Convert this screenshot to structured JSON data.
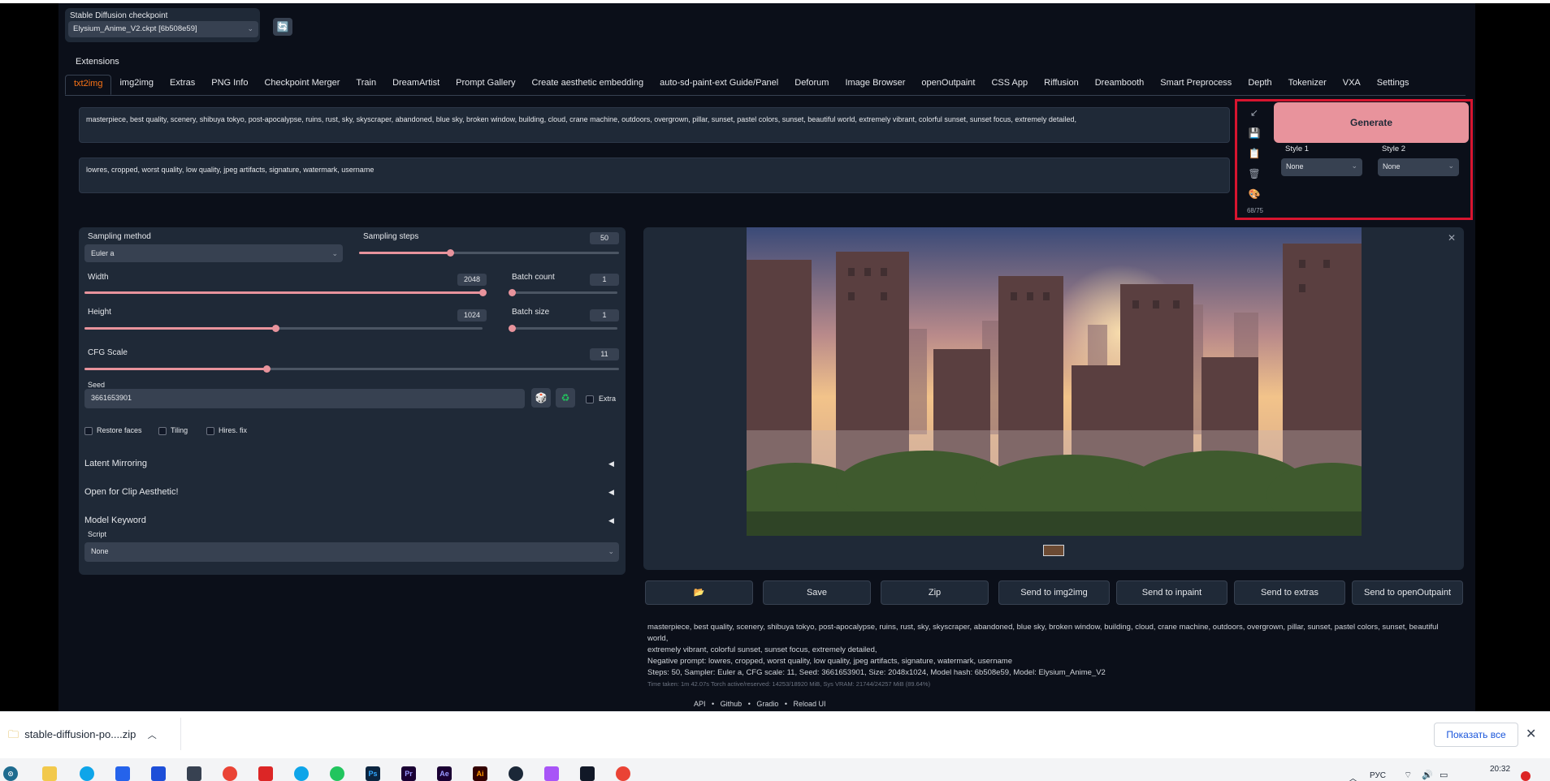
{
  "checkpoint": {
    "label": "Stable Diffusion checkpoint",
    "value": "Elysium_Anime_V2.ckpt [6b508e59]"
  },
  "extensions_label": "Extensions",
  "tabs": [
    "txt2img",
    "img2img",
    "Extras",
    "PNG Info",
    "Checkpoint Merger",
    "Train",
    "DreamArtist",
    "Prompt Gallery",
    "Create aesthetic embedding",
    "auto-sd-paint-ext Guide/Panel",
    "Deforum",
    "Image Browser",
    "openOutpaint",
    "CSS App",
    "Riffusion",
    "Dreambooth",
    "Smart Preprocess",
    "Depth",
    "Tokenizer",
    "VXA",
    "Settings"
  ],
  "prompt": "masterpiece, best quality, scenery, shibuya tokyo, post-apocalypse, ruins, rust, sky, skyscraper, abandoned, blue sky, broken window, building, cloud, crane machine, outdoors, overgrown, pillar, sunset, pastel colors, sunset, beautiful world, extremely vibrant, colorful sunset, sunset focus, extremely detailed,",
  "negative_prompt": "lowres, cropped, worst quality, low quality, jpeg artifacts, signature, watermark, username",
  "token_count": "68/75",
  "generate_label": "Generate",
  "style1": {
    "label": "Style 1",
    "value": "None"
  },
  "style2": {
    "label": "Style 2",
    "value": "None"
  },
  "sampling_method": {
    "label": "Sampling method",
    "value": "Euler a"
  },
  "sampling_steps": {
    "label": "Sampling steps",
    "value": "50",
    "fraction": 0.35
  },
  "width": {
    "label": "Width",
    "value": "2048",
    "fraction": 1.0
  },
  "height": {
    "label": "Height",
    "value": "1024",
    "fraction": 0.48
  },
  "batch_count": {
    "label": "Batch count",
    "value": "1",
    "fraction": 0.0
  },
  "batch_size": {
    "label": "Batch size",
    "value": "1",
    "fraction": 0.0
  },
  "cfg_scale": {
    "label": "CFG Scale",
    "value": "11",
    "fraction": 0.34
  },
  "seed": {
    "label": "Seed",
    "value": "3661653901",
    "extra_label": "Extra"
  },
  "checkboxes": {
    "restore_faces": "Restore faces",
    "tiling": "Tiling",
    "hires_fix": "Hires. fix"
  },
  "accordions": [
    "Latent Mirroring",
    "Open for Clip Aesthetic!",
    "Model Keyword"
  ],
  "script": {
    "label": "Script",
    "value": "None"
  },
  "output_buttons": {
    "folder": "📂",
    "save": "Save",
    "zip": "Zip",
    "img2img": "Send to img2img",
    "inpaint": "Send to inpaint",
    "extras": "Send to extras",
    "outpaint": "Send to openOutpaint"
  },
  "info": {
    "prompt": "masterpiece, best quality, scenery, shibuya tokyo, post-apocalypse, ruins, rust, sky, skyscraper, abandoned, blue sky, broken window, building, cloud, crane machine, outdoors, overgrown, pillar, sunset, pastel colors, sunset, beautiful world,",
    "prompt2": "extremely vibrant, colorful sunset, sunset focus, extremely detailed,",
    "negative": "Negative prompt: lowres, cropped, worst quality, low quality, jpeg artifacts, signature, watermark, username",
    "params": "Steps: 50, Sampler: Euler a, CFG scale: 11, Seed: 3661653901, Size: 2048x1024, Model hash: 6b508e59, Model: Elysium_Anime_V2",
    "time": "Time taken: 1m 42.07s   Torch active/reserved: 14253/18920 MiB, Sys VRAM: 21744/24257 MiB (89.64%)"
  },
  "footer": {
    "api": "API",
    "github": "Github",
    "gradio": "Gradio",
    "reload": "Reload UI"
  },
  "download": {
    "file": "stable-diffusion-po....zip",
    "show_all": "Показать все"
  },
  "taskbar": {
    "lang": "РУС",
    "time": "20:32"
  }
}
